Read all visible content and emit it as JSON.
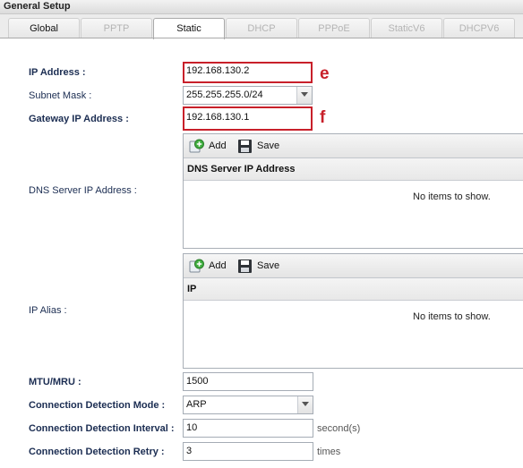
{
  "header": {
    "title": "General Setup"
  },
  "tabs": [
    {
      "label": "Global",
      "state": "enabled"
    },
    {
      "label": "PPTP",
      "state": "disabled"
    },
    {
      "label": "Static",
      "state": "active"
    },
    {
      "label": "DHCP",
      "state": "disabled"
    },
    {
      "label": "PPPoE",
      "state": "disabled"
    },
    {
      "label": "StaticV6",
      "state": "disabled"
    },
    {
      "label": "DHCPV6",
      "state": "disabled"
    }
  ],
  "form": {
    "ip_address": {
      "label": "IP Address :",
      "value": "192.168.130.2",
      "annotation": "e"
    },
    "subnet_mask": {
      "label": "Subnet Mask :",
      "value": "255.255.255.0/24"
    },
    "gateway": {
      "label": "Gateway IP Address :",
      "value": "192.168.130.1",
      "annotation": "f"
    },
    "dns": {
      "label": "DNS Server IP Address :",
      "add_label": "Add",
      "save_label": "Save",
      "column": "DNS Server IP Address",
      "empty_text": "No items to show."
    },
    "ip_alias": {
      "label": "IP Alias :",
      "add_label": "Add",
      "save_label": "Save",
      "column": "IP",
      "empty_text": "No items to show."
    },
    "mtu": {
      "label": "MTU/MRU :",
      "value": "1500"
    },
    "detection_mode": {
      "label": "Connection Detection Mode :",
      "value": "ARP"
    },
    "detection_interval": {
      "label": "Connection Detection Interval :",
      "value": "10",
      "unit": "second(s)"
    },
    "detection_retry": {
      "label": "Connection Detection Retry :",
      "value": "3",
      "unit": "times"
    }
  },
  "colors": {
    "highlight": "#c8202a",
    "label_text": "#1b2d52"
  }
}
